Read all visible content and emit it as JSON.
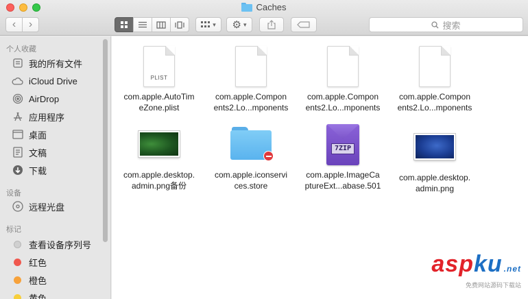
{
  "window": {
    "title": "Caches"
  },
  "toolbar": {
    "back_icon": "chevron-left-icon",
    "forward_icon": "chevron-right-icon",
    "search_placeholder": "搜索",
    "views": [
      "icon-view",
      "list-view",
      "column-view",
      "cover-flow-view"
    ]
  },
  "sidebar": {
    "favorites_title": "个人收藏",
    "favorites": [
      {
        "label": "我的所有文件",
        "icon": "all-files-icon"
      },
      {
        "label": "iCloud Drive",
        "icon": "cloud-icon"
      },
      {
        "label": "AirDrop",
        "icon": "airdrop-icon"
      },
      {
        "label": "应用程序",
        "icon": "applications-icon"
      },
      {
        "label": "桌面",
        "icon": "desktop-icon"
      },
      {
        "label": "文稿",
        "icon": "documents-icon"
      },
      {
        "label": "下载",
        "icon": "downloads-icon"
      }
    ],
    "devices_title": "设备",
    "devices": [
      {
        "label": "远程光盘",
        "icon": "disc-icon"
      }
    ],
    "tags_title": "标记",
    "tags": [
      {
        "label": "查看设备序列号",
        "color": "#d0d0d0"
      },
      {
        "label": "红色",
        "color": "#f0584e"
      },
      {
        "label": "橙色",
        "color": "#f7a23b"
      },
      {
        "label": "黄色",
        "color": "#f7cf3b"
      }
    ]
  },
  "files": [
    {
      "name": "com.apple.AutoTimeZone.plist",
      "line1": "com.apple.AutoTim",
      "line2": "eZone.plist",
      "kind": "plist",
      "doc_label": "PLIST"
    },
    {
      "name": "com.apple.Components2",
      "line1": "com.apple.Compon",
      "line2": "ents2.Lo...mponents",
      "kind": "doc"
    },
    {
      "name": "com.apple.Components2",
      "line1": "com.apple.Compon",
      "line2": "ents2.Lo...mponents",
      "kind": "doc"
    },
    {
      "name": "com.apple.Components2",
      "line1": "com.apple.Compon",
      "line2": "ents2.Lo...mponents",
      "kind": "doc"
    },
    {
      "name": "com.apple.desktop.admin.png备份",
      "line1": "com.apple.desktop.",
      "line2": "admin.png备份",
      "kind": "image-green"
    },
    {
      "name": "com.apple.iconservices.store",
      "line1": "com.apple.iconservi",
      "line2": "ces.store",
      "kind": "folder"
    },
    {
      "name": "com.apple.ImageCaptureExt...abase.501",
      "line1": "com.apple.ImageCa",
      "line2": "ptureExt...abase.501",
      "kind": "zip",
      "zip_label": "7ZIP"
    },
    {
      "name": "com.apple.desktop.admin.png",
      "line1": "com.apple.desktop.",
      "line2": "admin.png",
      "kind": "image-blue"
    }
  ],
  "watermark": {
    "asp": "asp",
    "ku": "ku",
    "net": ".net",
    "sub": "免费网站源码下载站"
  }
}
